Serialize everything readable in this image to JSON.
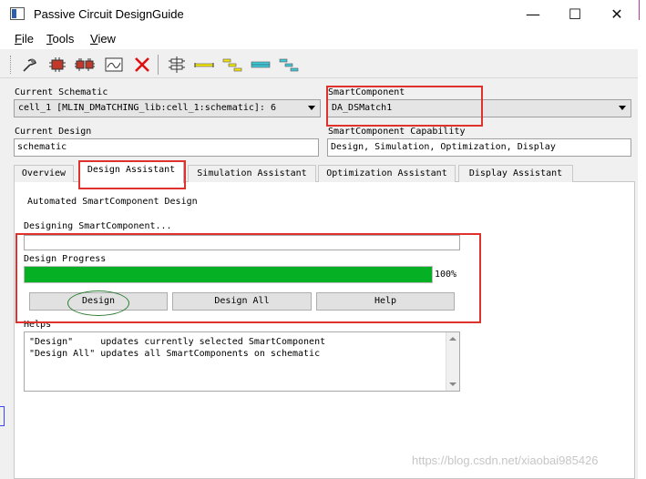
{
  "window": {
    "title": "Passive Circuit DesignGuide",
    "minimize_glyph": "—",
    "maximize_glyph": "☐",
    "close_glyph": "✕"
  },
  "menu": {
    "file": {
      "accel": "F",
      "rest": "ile"
    },
    "tools": {
      "accel": "T",
      "rest": "ools"
    },
    "view": {
      "accel": "V",
      "rest": "iew"
    }
  },
  "toolbar": {
    "icons": [
      "probe-icon",
      "component-icon",
      "components-icon",
      "plot-icon",
      "delete-icon",
      "align-icon",
      "flat-line-icon",
      "stair-icon",
      "cyan-line-icon",
      "stair2-icon"
    ]
  },
  "schematic": {
    "current_schematic_label": "Current Schematic",
    "current_schematic_value": "cell_1 [MLIN_DMaTCHING_lib:cell_1:schematic]: 6",
    "smart_component_label": "SmartComponent",
    "smart_component_value": "DA_DSMatch1",
    "current_design_label": "Current Design",
    "current_design_value": "schematic",
    "capability_label": "SmartComponent Capability",
    "capability_value": "Design, Simulation, Optimization, Display"
  },
  "tabs": [
    "Overview",
    "Design Assistant",
    "Simulation Assistant",
    "Optimization Assistant",
    "Display Assistant"
  ],
  "panel": {
    "heading": "Automated SmartComponent Design",
    "designing_label": "Designing SmartComponent...",
    "progress_label": "Design Progress",
    "progress_text": "100%",
    "progress_value": 1.0,
    "buttons": {
      "design": "Design",
      "design_all": "Design All",
      "help": "Help"
    },
    "helps_label": "Helps",
    "helps_lines": [
      "\"Design\"     updates currently selected SmartComponent",
      "\"Design All\" updates all SmartComponents on schematic"
    ]
  },
  "watermark": "https://blog.csdn.net/xiaobai985426",
  "colors": {
    "progress_fill": "#06b025",
    "highlight_red": "#e0322c",
    "annotation_green": "#2e7d32"
  }
}
